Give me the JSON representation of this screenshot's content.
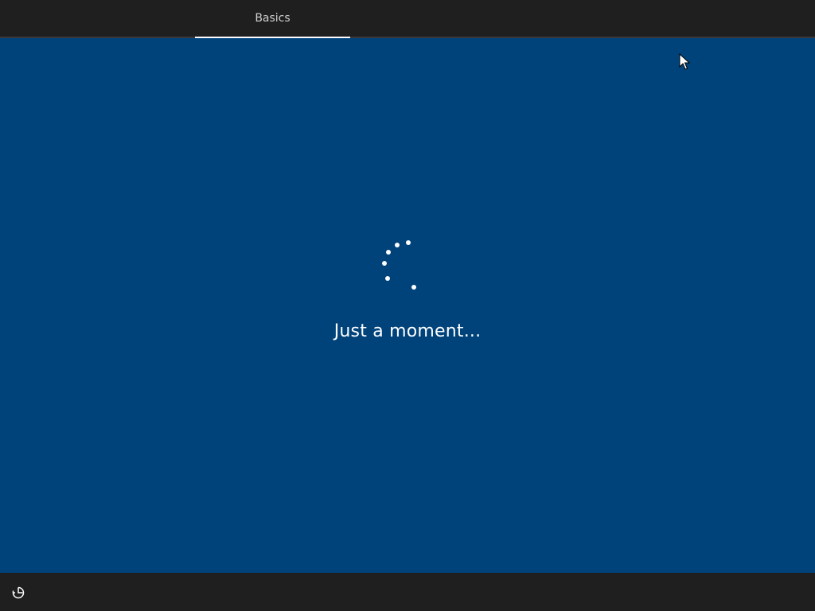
{
  "header": {
    "tabs": [
      {
        "label": "Basics",
        "active": true
      }
    ]
  },
  "main": {
    "status_text": "Just a moment...",
    "spinner_icon": "loading-spinner-icon",
    "background_color": "#00427a"
  },
  "footer": {
    "ease_of_access_icon": "ease-of-access-icon"
  },
  "colors": {
    "bar_background": "#1f1f1f",
    "text_primary": "#ffffff",
    "tab_text": "#cfcfcf"
  }
}
